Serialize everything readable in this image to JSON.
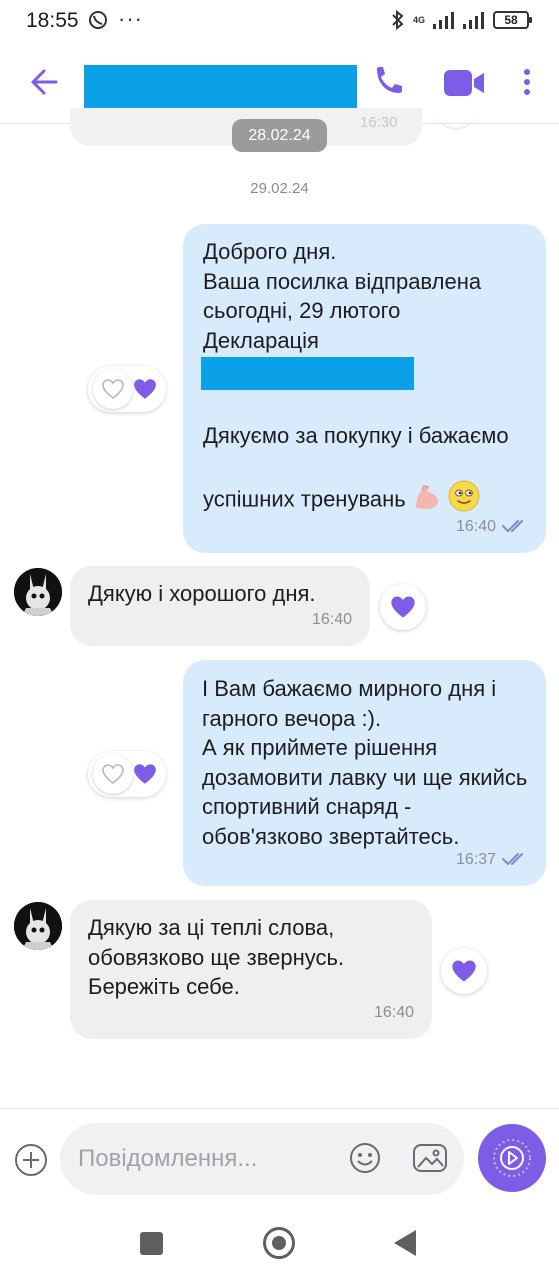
{
  "status_bar": {
    "time": "18:55",
    "more": "···",
    "network": "4G",
    "battery": "58"
  },
  "header": {
    "contact_name": "",
    "accent_color": "#7d5ce6"
  },
  "conversation": {
    "previous_message_time": "16:30",
    "date_chip_1": "28.02.24",
    "date_chip_2": "29.02.24",
    "messages": [
      {
        "direction": "outgoing",
        "text_top": "Доброго дня.\nВаша посилка відправлена сьогодні, 29 лютого\nДекларація",
        "text_bottom": "Дякуємо за покупку і бажаємо успішних тренувань",
        "emoji": [
          "flexed-biceps",
          "smiling-face"
        ],
        "time": "16:40",
        "read": true,
        "reactions": [
          "heart-outline",
          "heart-filled"
        ]
      },
      {
        "direction": "incoming",
        "text": "Дякую і хорошого дня.",
        "time": "16:40",
        "reactions": [
          "heart-filled"
        ]
      },
      {
        "direction": "outgoing",
        "text": "І Вам бажаємо мирного дня і гарного вечора :).\nА як приймете рішення дозамовити лавку чи ще якийсь спортивний снаряд - обов'язково звертайтесь.",
        "time": "16:37",
        "read": true,
        "reactions": [
          "heart-outline",
          "heart-filled"
        ]
      },
      {
        "direction": "incoming",
        "text": "Дякую за ці теплі слова, обовязково ще звернусь. Бережіть себе.",
        "time": "16:40",
        "reactions": [
          "heart-filled"
        ]
      }
    ]
  },
  "input": {
    "placeholder": "Повідомлення..."
  },
  "colors": {
    "outgoing_bubble": "#d8ebfd",
    "incoming_bubble": "#efefef",
    "redaction": "#0aa1e8",
    "heart": "#7d5ce6"
  }
}
